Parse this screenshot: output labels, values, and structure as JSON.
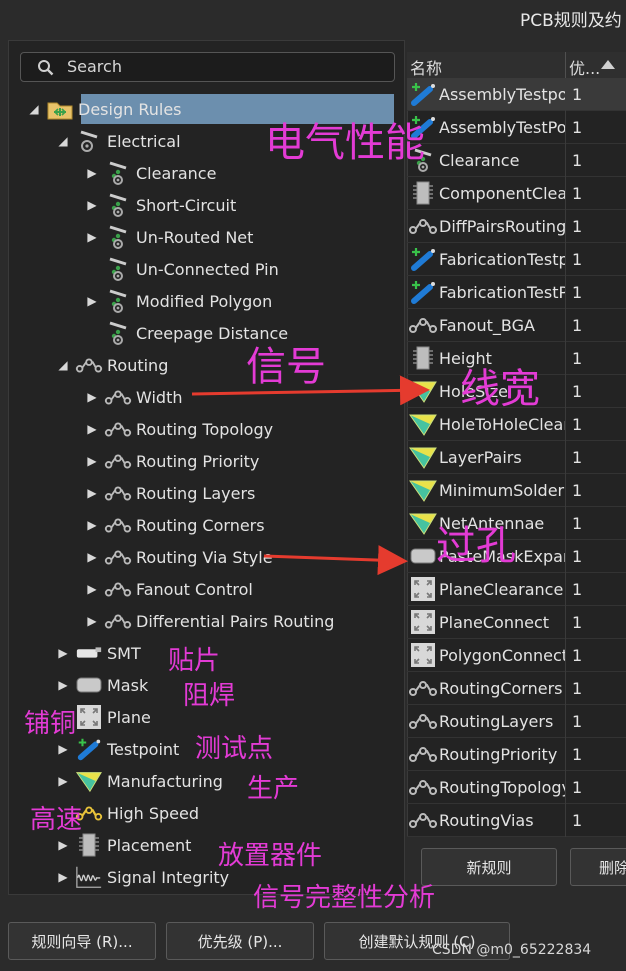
{
  "window": {
    "title": "PCB规则及约"
  },
  "search": {
    "placeholder": "Search"
  },
  "tree": [
    {
      "label": "Design Rules",
      "icon": "design-rules-folder-icon",
      "expanded": true
    },
    {
      "label": "Electrical",
      "icon": "electrical-icon",
      "expanded": true
    },
    {
      "label": "Clearance",
      "icon": "electrical-rule-icon"
    },
    {
      "label": "Short-Circuit",
      "icon": "electrical-rule-icon"
    },
    {
      "label": "Un-Routed Net",
      "icon": "electrical-rule-icon"
    },
    {
      "label": "Un-Connected Pin",
      "icon": "electrical-rule-icon"
    },
    {
      "label": "Modified Polygon",
      "icon": "electrical-rule-icon"
    },
    {
      "label": "Creepage Distance",
      "icon": "electrical-rule-icon"
    },
    {
      "label": "Routing",
      "icon": "routing-icon",
      "expanded": true
    },
    {
      "label": "Width",
      "icon": "routing-icon"
    },
    {
      "label": "Routing Topology",
      "icon": "routing-icon"
    },
    {
      "label": "Routing Priority",
      "icon": "routing-icon"
    },
    {
      "label": "Routing Layers",
      "icon": "routing-icon"
    },
    {
      "label": "Routing Corners",
      "icon": "routing-icon"
    },
    {
      "label": "Routing Via Style",
      "icon": "routing-icon"
    },
    {
      "label": "Fanout Control",
      "icon": "routing-icon"
    },
    {
      "label": "Differential Pairs Routing",
      "icon": "routing-icon"
    },
    {
      "label": "SMT",
      "icon": "smt-icon"
    },
    {
      "label": "Mask",
      "icon": "mask-icon"
    },
    {
      "label": "Plane",
      "icon": "plane-icon"
    },
    {
      "label": "Testpoint",
      "icon": "testpoint-icon"
    },
    {
      "label": "Manufacturing",
      "icon": "manufacturing-icon"
    },
    {
      "label": "High Speed",
      "icon": "high-speed-icon"
    },
    {
      "label": "Placement",
      "icon": "placement-icon"
    },
    {
      "label": "Signal Integrity",
      "icon": "signal-integrity-icon"
    }
  ],
  "grid": {
    "col_name": "名称",
    "col_priority": "优...",
    "rows": [
      {
        "name": "AssemblyTestpoint",
        "priority": "1",
        "icon": "testpoint-icon"
      },
      {
        "name": "AssemblyTestPoint",
        "priority": "1",
        "icon": "testpoint-icon"
      },
      {
        "name": "Clearance",
        "priority": "1",
        "icon": "electrical-rule-icon"
      },
      {
        "name": "ComponentClearance",
        "priority": "1",
        "icon": "placement-icon"
      },
      {
        "name": "DiffPairsRouting",
        "priority": "1",
        "icon": "routing-icon"
      },
      {
        "name": "FabricationTestpoint",
        "priority": "1",
        "icon": "testpoint-icon"
      },
      {
        "name": "FabricationTestPoint",
        "priority": "1",
        "icon": "testpoint-icon"
      },
      {
        "name": "Fanout_BGA",
        "priority": "1",
        "icon": "routing-icon"
      },
      {
        "name": "Height",
        "priority": "1",
        "icon": "placement-icon"
      },
      {
        "name": "HoleSize",
        "priority": "1",
        "icon": "manufacturing-icon"
      },
      {
        "name": "HoleToHoleClearance",
        "priority": "1",
        "icon": "manufacturing-icon"
      },
      {
        "name": "LayerPairs",
        "priority": "1",
        "icon": "manufacturing-icon"
      },
      {
        "name": "MinimumSolderMaskSliver",
        "priority": "1",
        "icon": "manufacturing-icon"
      },
      {
        "name": "NetAntennae",
        "priority": "1",
        "icon": "manufacturing-icon"
      },
      {
        "name": "PasteMaskExpansion",
        "priority": "1",
        "icon": "mask-icon"
      },
      {
        "name": "PlaneClearance",
        "priority": "1",
        "icon": "plane-icon"
      },
      {
        "name": "PlaneConnect",
        "priority": "1",
        "icon": "plane-icon"
      },
      {
        "name": "PolygonConnect",
        "priority": "1",
        "icon": "plane-icon"
      },
      {
        "name": "RoutingCorners",
        "priority": "1",
        "icon": "routing-icon"
      },
      {
        "name": "RoutingLayers",
        "priority": "1",
        "icon": "routing-icon"
      },
      {
        "name": "RoutingPriority",
        "priority": "1",
        "icon": "routing-icon"
      },
      {
        "name": "RoutingTopology",
        "priority": "1",
        "icon": "routing-icon"
      },
      {
        "name": "RoutingVias",
        "priority": "1",
        "icon": "routing-icon"
      }
    ]
  },
  "buttons": {
    "new_rule": "新规则",
    "delete": "删除",
    "rule_wizard": "规则向导 (R)...",
    "priority": "优先级 (P)...",
    "create_default": "创建默认规则 (C)"
  },
  "annotations": {
    "electrical": "电气性能",
    "signal": "信号",
    "line_width": "线宽",
    "via": "过孔",
    "smt": "贴片",
    "mask": "阻焊",
    "plane": "铺铜",
    "testpoint": "测试点",
    "manufacturing": "生产",
    "high_speed": "高速",
    "placement": "放置器件",
    "signal_integrity": "信号完整性分析"
  },
  "watermark": "CSDN @m0_65222834",
  "colors": {
    "selection": "#6c8fae",
    "annotation": "#e33bd5",
    "arrow": "#e53b2e"
  }
}
